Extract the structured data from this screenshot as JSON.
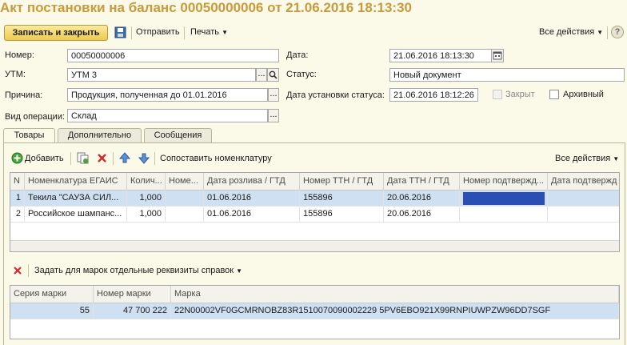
{
  "title": "Акт постановки на баланс 00050000006 от 21.06.2016 18:13:30",
  "toolbar": {
    "save_close": "Записать и закрыть",
    "send": "Отправить",
    "print": "Печать",
    "all_actions": "Все действия",
    "help": "?"
  },
  "form": {
    "number_label": "Номер:",
    "number_value": "00050000006",
    "date_label": "Дата:",
    "date_value": "21.06.2016 18:13:30",
    "utm_label": "УТМ:",
    "utm_value": "УТМ 3",
    "status_label": "Статус:",
    "status_value": "Новый документ",
    "reason_label": "Причина:",
    "reason_value": "Продукция, полученная до 01.01.2016",
    "status_date_label": "Дата установки статуса:",
    "status_date_value": "21.06.2016 18:12:26",
    "closed_label": "Закрыт",
    "archived_label": "Архивный",
    "operation_label": "Вид операции:",
    "operation_value": "Склад"
  },
  "tabs": [
    "Товары",
    "Дополнительно",
    "Сообщения"
  ],
  "goods_toolbar": {
    "add": "Добавить",
    "match": "Сопоставить номенклатуру",
    "all_actions": "Все действия"
  },
  "goods_table": {
    "headers": [
      "N",
      "Номенклатура ЕГАИС",
      "Колич...",
      "Номе...",
      "Дата розлива / ГТД",
      "Номер ТТН / ГТД",
      "Дата ТТН / ГТД",
      "Номер подтвержд...",
      "Дата подтвержд"
    ],
    "rows": [
      [
        "1",
        "Текила \"САУЗА СИЛ...",
        "1,000",
        "",
        "01.06.2016",
        "155896",
        "20.06.2016",
        "",
        ""
      ],
      [
        "2",
        "Российское шампанс...",
        "1,000",
        "",
        "01.06.2016",
        "155896",
        "20.06.2016",
        "",
        ""
      ]
    ]
  },
  "marks_toolbar": {
    "set_details": "Задать для марок отдельные реквизиты справок"
  },
  "marks_table": {
    "headers": [
      "Серия марки",
      "Номер марки",
      "Марка"
    ],
    "rows": [
      [
        "55",
        "47 700 222",
        "22N00002VF0GCMRNOBZ83R1510070090002229 5PV6EBO921X99RNPIUWPZW96DD7SGF"
      ]
    ]
  },
  "colors": {
    "title": "#c89a3c",
    "selection": "#cfe0f3",
    "active_cell": "#2a4fb4"
  }
}
